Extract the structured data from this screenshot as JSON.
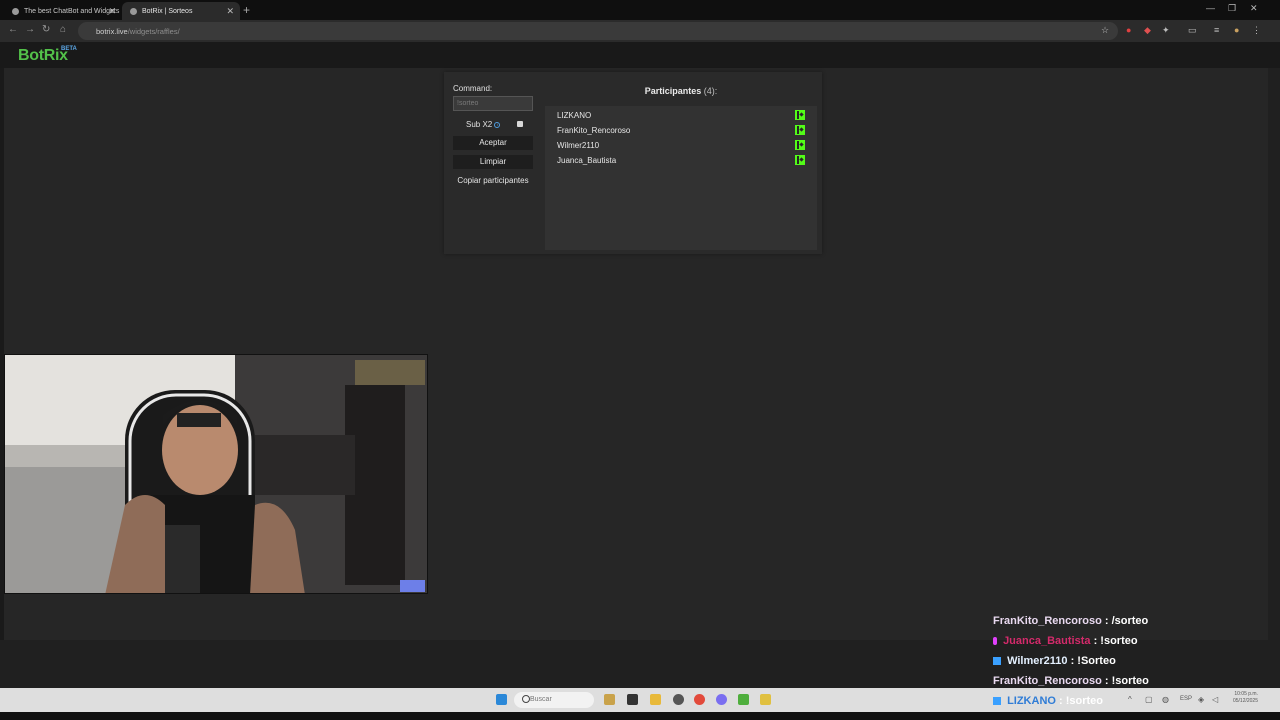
{
  "browser": {
    "tabs": [
      {
        "title": "The best ChatBot and Widgets"
      },
      {
        "title": "BotRix | Sorteos"
      }
    ],
    "url_domain": "botrix.live",
    "url_path": "/widgets/raffles/"
  },
  "app": {
    "logo": "BotRix",
    "badge": "BETA"
  },
  "raffle": {
    "command_label": "Command:",
    "command_placeholder": "!sorteo",
    "sub_label": "Sub X2",
    "accept_label": "Aceptar",
    "clear_label": "Limpiar",
    "copy_label": "Copiar participantes",
    "participants_title": "Participantes",
    "participants_count": "(4):",
    "participants": [
      {
        "name": "LIZKANO"
      },
      {
        "name": "FranKito_Rencoroso"
      },
      {
        "name": "Wilmer2110"
      },
      {
        "name": "Juanca_Bautista"
      }
    ]
  },
  "chat": [
    {
      "user": "FranKito_Rencoroso",
      "message": ": /sorteo",
      "user_color": "#f0dcf0",
      "badge_color": ""
    },
    {
      "user": "Juanca_Bautista",
      "message": ": !sorteo",
      "user_color": "#d42a6b",
      "badge_color": "#e040fb"
    },
    {
      "user": "Wilmer2110",
      "message": ": !Sorteo",
      "user_color": "#e4f0ff",
      "badge_color": "#3aa0ff"
    },
    {
      "user": "FranKito_Rencoroso",
      "message": ": !sorteo",
      "user_color": "#f0dcf0",
      "badge_color": ""
    },
    {
      "user": "LIZKANO",
      "message": ": !sorteo",
      "user_color": "#2f7cd6",
      "badge_color": "#3aa0ff"
    }
  ],
  "taskbar": {
    "search_placeholder": "Buscar",
    "lang": "ESP",
    "time": "10:05 p.m.",
    "date": "05/12/2025"
  },
  "colors": {
    "brand_green": "#53c14a",
    "kick_green": "#53fc18"
  }
}
